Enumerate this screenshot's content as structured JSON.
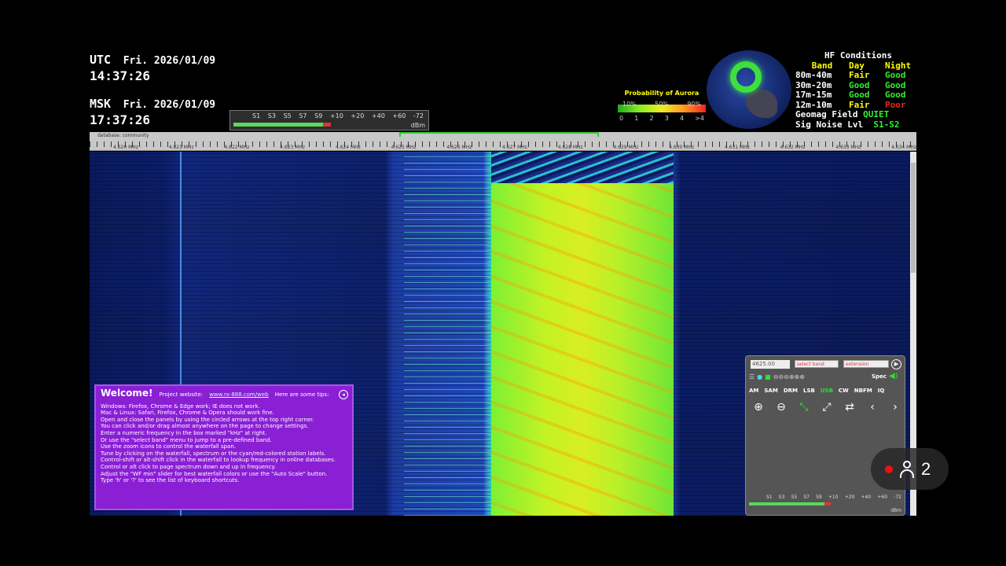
{
  "clocks": [
    {
      "label": "UTC",
      "date": "Fri. 2026/01/09",
      "time": "14:37:26"
    },
    {
      "label": "MSK",
      "date": "Fri. 2026/01/09",
      "time": "17:37:26"
    }
  ],
  "smeter": {
    "scale": [
      "S1",
      "S3",
      "S5",
      "S7",
      "S9",
      "+10",
      "+20",
      "+40",
      "+60",
      "-72"
    ],
    "unit": "dBm",
    "level": 0.52
  },
  "aurora": {
    "title": "Probability of Aurora",
    "percents": [
      "10%",
      "50%",
      "90%"
    ],
    "ticks": [
      "0",
      "1",
      "2",
      "3",
      "4",
      ">4"
    ]
  },
  "hf": {
    "title": "HF Conditions",
    "header": [
      "Band",
      "Day",
      "Night"
    ],
    "rows": [
      {
        "band": "80m-40m",
        "day": "Fair",
        "night": "Good"
      },
      {
        "band": "30m-20m",
        "day": "Good",
        "night": "Good"
      },
      {
        "band": "17m-15m",
        "day": "Good",
        "night": "Good"
      },
      {
        "band": "12m-10m",
        "day": "Fair",
        "night": "Poor"
      }
    ],
    "geomag_label": "Geomag Field",
    "geomag_value": "QUIET",
    "noise_label": "Sig Noise Lvl",
    "noise_value": "S1-S2"
  },
  "freq_scale": {
    "database": "database: community",
    "labels": [
      "4.620 MHz",
      "4.621 MHz",
      "4.622 MHz",
      "4.623 MHz",
      "4.624 MHz",
      "4.625 MHz",
      "4.626 MHz",
      "4.627 MHz",
      "4.628 MHz",
      "4.629 MHz",
      "4.630 MHz",
      "4.631 MHz",
      "4.632 MHz",
      "4.633 MHz",
      "4.634 MHz"
    ]
  },
  "welcome": {
    "title": "Welcome!",
    "project_label": "Project website:",
    "project_link": "www.rx-888.com/web",
    "tips_label": "Here are some tips:",
    "tips": [
      "Windows: Firefox, Chrome & Edge work; IE does not work.",
      "Mac & Linux: Safari, Firefox, Chrome & Opera should work fine.",
      "Open and close the panels by using the circled arrows at the top right corner.",
      "You can click and/or drag almost anywhere on the page to change settings.",
      "Enter a numeric frequency in the box marked \"kHz\" at right.",
      "Or use the \"select band\" menu to jump to a pre-defined band.",
      "Use the zoom icons to control the waterfall span.",
      "Tune by clicking on the waterfall, spectrum or the cyan/red-colored station labels.",
      "Control-shift or alt-shift click in the waterfall to lookup frequency in online databases.",
      "Control or alt click to page spectrum down and up in frequency.",
      "Adjust the \"WF min\" slider for best waterfall colors or use the \"Auto Scale\" button.",
      "Type 'h' or '?' to see the list of keyboard shortcuts."
    ]
  },
  "panel": {
    "freq": "4625.00",
    "band_select": "select band",
    "ext_select": "extension",
    "spec": "Spec",
    "modes": [
      "AM",
      "SAM",
      "DRM",
      "LSB",
      "USB",
      "CW",
      "NBFM",
      "IQ"
    ],
    "active_mode": "USB",
    "smeter_scale": [
      "S1",
      "S3",
      "S5",
      "S7",
      "S9",
      "+10",
      "+20",
      "+40",
      "+60",
      "-72"
    ],
    "smeter_unit": "dBm"
  },
  "viewers": {
    "count": "2"
  }
}
